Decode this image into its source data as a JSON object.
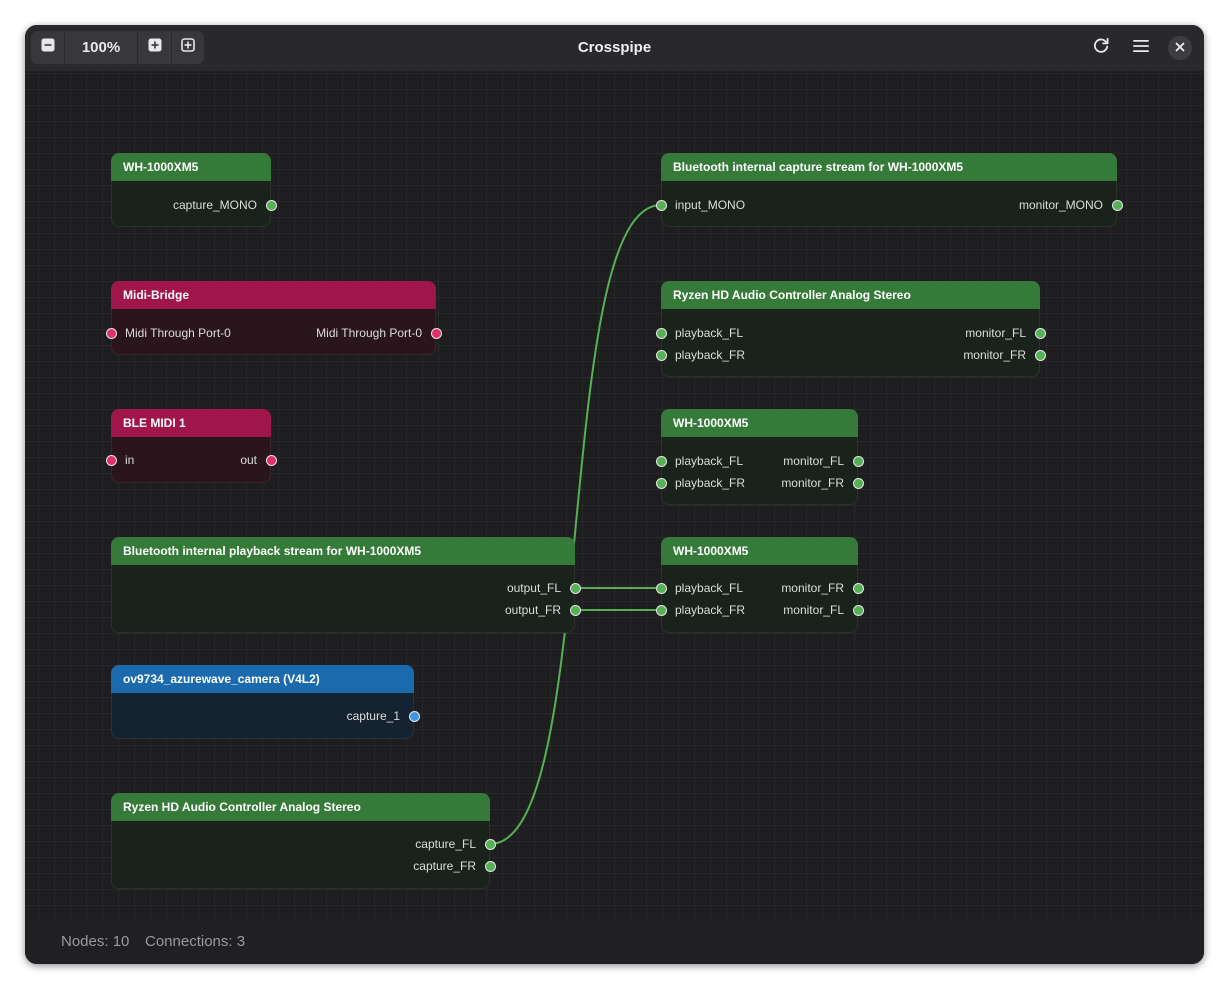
{
  "window": {
    "title": "Crosspipe",
    "zoom": "100%",
    "icons": {
      "zoom_out": "zoom-out-icon",
      "zoom_in": "zoom-in-icon",
      "zoom_fit": "zoom-fit-icon",
      "refresh": "refresh-icon",
      "menu": "hamburger-menu-icon",
      "close": "close-icon"
    }
  },
  "status": {
    "nodes": "Nodes: 10",
    "connections": "Connections: 3"
  },
  "colors": {
    "audio_header": "#357a38",
    "midi_header": "#a1164a",
    "video_header": "#1c6aae",
    "audio_port": "#55b057",
    "midi_port": "#e1306c",
    "video_port": "#3f96e6",
    "link": "#55b057"
  },
  "nodes": {
    "wh_source": {
      "title": "WH-1000XM5",
      "out1": "capture_MONO"
    },
    "midi_bridge": {
      "title": "Midi-Bridge",
      "in1": "Midi Through Port-0",
      "out1": "Midi Through Port-0"
    },
    "ble_midi": {
      "title": "BLE MIDI 1",
      "in1": "in",
      "out1": "out"
    },
    "bt_playback": {
      "title": "Bluetooth internal playback stream for WH-1000XM5",
      "out1": "output_FL",
      "out2": "output_FR"
    },
    "camera": {
      "title": "ov9734_azurewave_camera (V4L2)",
      "out1": "capture_1"
    },
    "ryzen_capture": {
      "title": "Ryzen HD Audio Controller Analog Stereo",
      "out1": "capture_FL",
      "out2": "capture_FR"
    },
    "bt_capture": {
      "title": "Bluetooth internal capture stream for WH-1000XM5",
      "in1": "input_MONO",
      "out1": "monitor_MONO"
    },
    "ryzen_sink": {
      "title": "Ryzen HD Audio Controller Analog Stereo",
      "in1": "playback_FL",
      "in2": "playback_FR",
      "out1": "monitor_FL",
      "out2": "monitor_FR"
    },
    "wh_sink_a": {
      "title": "WH-1000XM5",
      "in1": "playback_FL",
      "in2": "playback_FR",
      "out1": "monitor_FL",
      "out2": "monitor_FR"
    },
    "wh_sink_b": {
      "title": "WH-1000XM5",
      "in1": "playback_FL",
      "in2": "playback_FR",
      "out1": "monitor_FR",
      "out2": "monitor_FL"
    }
  },
  "links": [
    {
      "from": "Ryzen HD Audio Controller Analog Stereo:capture_FL",
      "to": "Bluetooth internal capture stream for WH-1000XM5:input_MONO"
    },
    {
      "from": "Bluetooth internal playback stream for WH-1000XM5:output_FL",
      "to": "WH-1000XM5:playback_FL"
    },
    {
      "from": "Bluetooth internal playback stream for WH-1000XM5:output_FR",
      "to": "WH-1000XM5:playback_FR"
    }
  ]
}
